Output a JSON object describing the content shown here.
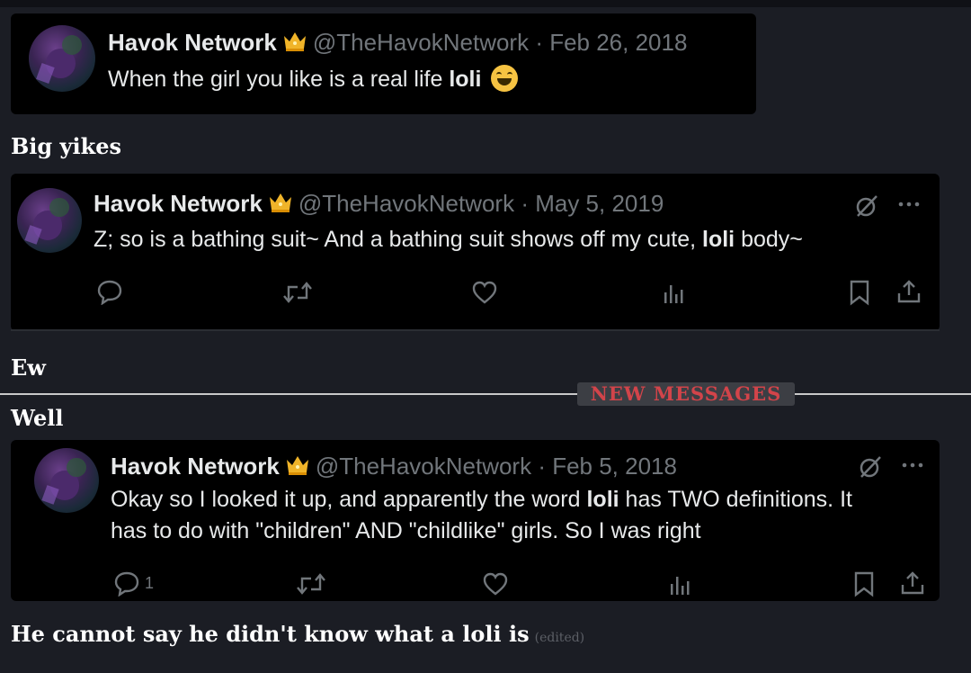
{
  "tweet1": {
    "name": "Havok Network",
    "handle_date": "@TheHavokNetwork · Feb 26, 2018",
    "text_before": "When the girl you like is a real life ",
    "text_bold": "loli",
    "emoji": "grinning-squinting-face"
  },
  "msg1": {
    "text": "Big yikes"
  },
  "tweet2": {
    "name": "Havok Network",
    "handle_date": "@TheHavokNetwork · May 5, 2019",
    "text_before": "Z; so is a bathing suit~ And a bathing suit shows off my cute, ",
    "text_bold": "loli",
    "text_after": " body~"
  },
  "msg2": {
    "text": "Ew"
  },
  "divider": {
    "label": "NEW MESSAGES"
  },
  "msg3": {
    "text": "Well"
  },
  "tweet3": {
    "name": "Havok Network",
    "handle_date": "@TheHavokNetwork · Feb 5, 2018",
    "line1_before": "Okay so I looked it up, and apparently the word ",
    "line1_bold": "loli",
    "line1_after": " has TWO definitions. It",
    "line2": "has to do with \"children\" AND \"childlike\" girls. So I was right",
    "reply_count": "1"
  },
  "msg4": {
    "text": "He cannot say he didn't know what a loli is",
    "edited": "(edited)"
  },
  "colors": {
    "accent_red": "#d2444a",
    "muted": "#71767b",
    "crown": "#f0b429"
  }
}
